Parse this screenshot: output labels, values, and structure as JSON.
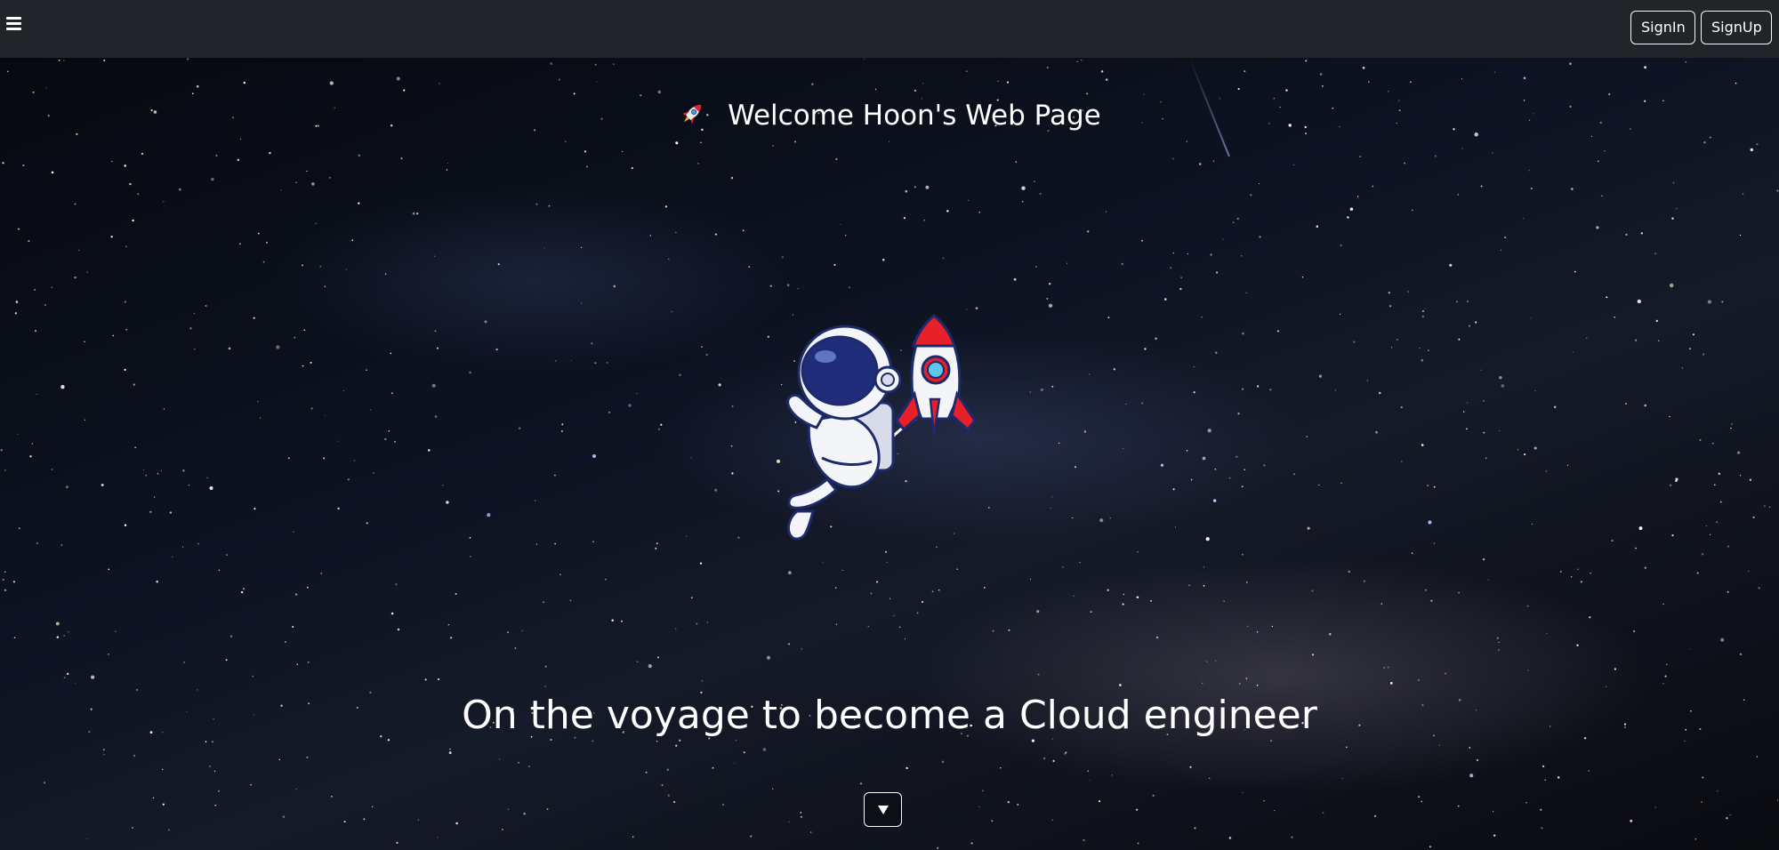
{
  "navbar": {
    "menu_icon": "hamburger-menu-icon",
    "signin_label": "SignIn",
    "signup_label": "SignUp",
    "background_color": "#212529"
  },
  "hero": {
    "welcome_icon": "rocket-emoji-icon",
    "welcome_text": "Welcome Hoon's Web Page",
    "illustration": "astronaut-with-rocket-illustration",
    "tagline": "On the voyage to become a Cloud engineer",
    "scroll_icon": "caret-down-icon",
    "background": "starry-night-sky-milky-way"
  },
  "colors": {
    "text": "#ffffff",
    "rocket_red": "#e8202a",
    "astronaut_visor": "#1f2d7a"
  }
}
